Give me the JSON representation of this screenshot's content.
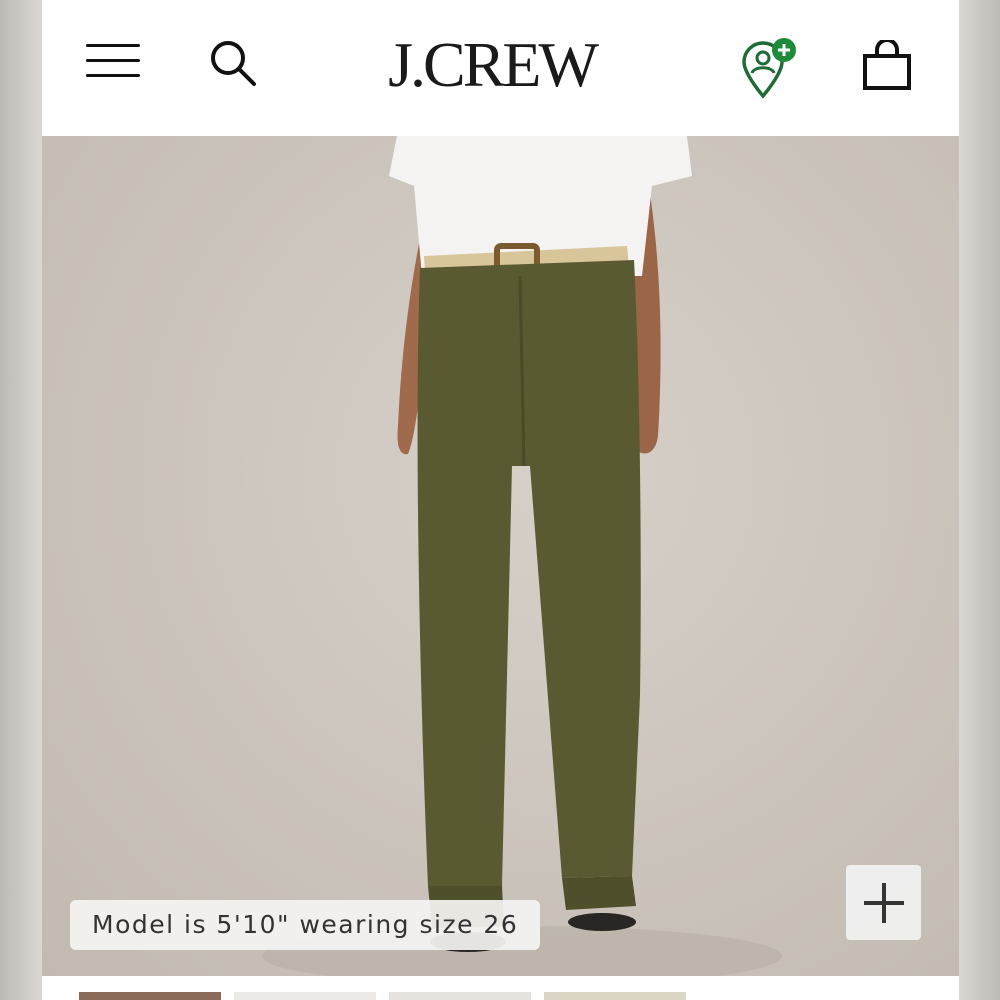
{
  "header": {
    "logo_text": "J.CREW",
    "icons": [
      "menu-icon",
      "search-icon",
      "account-location-icon",
      "shopping-bag-icon"
    ]
  },
  "hero": {
    "image_alt": "Model wearing olive corduroy wide-leg pants with white tee and tan belt",
    "model_caption": "Model is 5'10\" wearing size 26"
  },
  "thumbnails": {
    "count": 4
  },
  "colors": {
    "accent_green": "#1f8a3a",
    "pants_olive": "#5a5a32",
    "background_beige": "#cdc6be"
  }
}
